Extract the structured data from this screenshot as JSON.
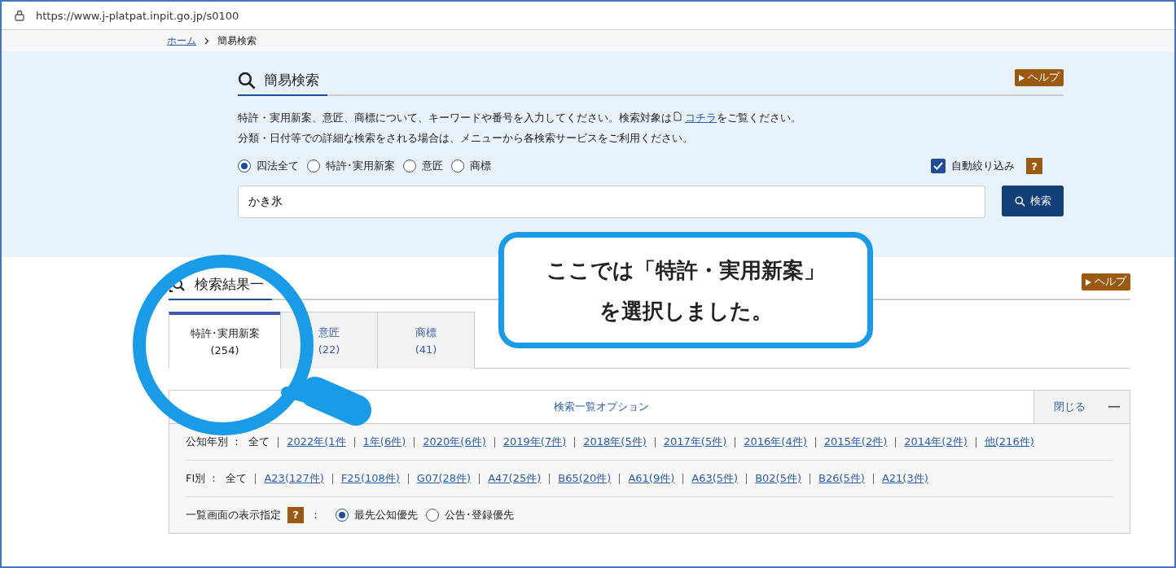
{
  "address_bar": {
    "url": "https://www.j-platpat.inpit.go.jp/s0100"
  },
  "breadcrumb": [
    {
      "label": "ホーム",
      "kind": "link"
    },
    {
      "label": "簡易検索",
      "kind": "current"
    }
  ],
  "simple_search": {
    "title": "簡易検索",
    "help": "ヘルプ",
    "note_1": {
      "before": "特許・実用新案、意匠、商標について、キーワードや番号を入力してください。検索対象は",
      "link": "コチラ",
      "after": "をご覧ください。"
    },
    "note_2": "分類・日付等での詳細な検索をされる場合は、メニューから各検索サービスをご利用ください。",
    "targets": [
      {
        "label": "四法全て",
        "selected": true
      },
      {
        "label": "特許･実用新案",
        "selected": false
      },
      {
        "label": "意匠",
        "selected": false
      },
      {
        "label": "商標",
        "selected": false
      }
    ],
    "auto_filter": {
      "label": "自動絞り込み",
      "checked": true,
      "help": "?"
    },
    "query": {
      "value": "かき氷"
    },
    "search_button": "検索"
  },
  "results": {
    "title": "検索結果一",
    "help": "ヘルプ",
    "tabs": [
      {
        "label": "特許･実用新案",
        "count": "(254)",
        "selected": true
      },
      {
        "label": "意匠",
        "count": "(22)",
        "selected": false
      },
      {
        "label": "商標",
        "count": "(41)",
        "selected": false
      }
    ],
    "options": {
      "title": "検索一覧オプション",
      "close": "閉じる",
      "year_filter": {
        "label": "公知年別 ：",
        "all": "全て",
        "items": [
          "2022年(1件",
          "1年(6件)",
          "2020年(6件)",
          "2019年(7件)",
          "2018年(5件)",
          "2017年(5件)",
          "2016年(4件)",
          "2015年(2件)",
          "2014年(2件)",
          "他(216件)"
        ]
      },
      "fi_filter": {
        "label": "FI別 ：",
        "all": "全て",
        "items": [
          "A23(127件)",
          "F25(108件)",
          "G07(28件)",
          "A47(25件)",
          "B65(20件)",
          "A61(9件)",
          "A63(5件)",
          "B02(5件)",
          "B26(5件)",
          "A21(3件)"
        ]
      },
      "display": {
        "label": "一覧画面の表示指定",
        "help": "?",
        "colon": "：",
        "choices": [
          {
            "label": "最先公知優先",
            "selected": true
          },
          {
            "label": "公告･登録優先",
            "selected": false
          }
        ]
      }
    }
  },
  "callout": {
    "lines": [
      "ここでは「特許・実用新案」",
      "を選択しました。"
    ]
  }
}
